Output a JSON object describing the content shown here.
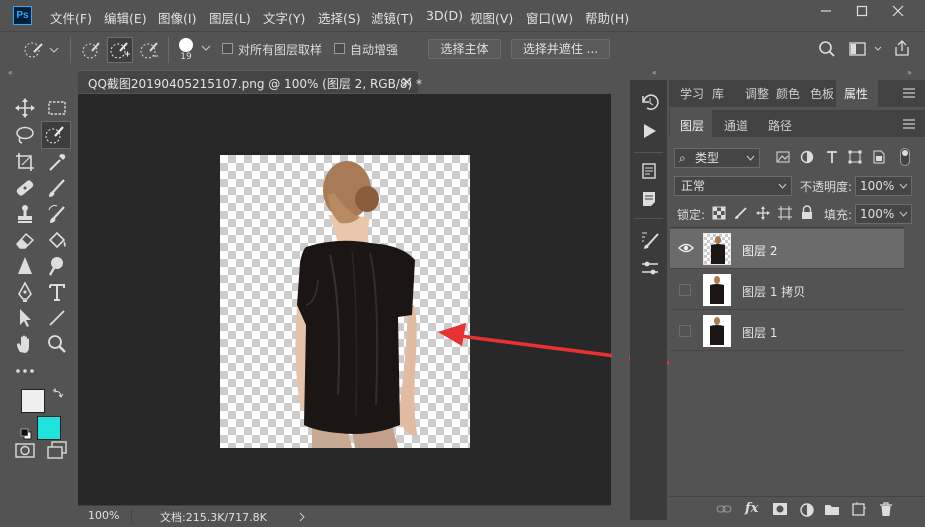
{
  "app": {
    "logo_text": "Ps"
  },
  "menu": [
    "文件(F)",
    "编辑(E)",
    "图像(I)",
    "图层(L)",
    "文字(Y)",
    "选择(S)",
    "滤镜(T)",
    "3D(D)",
    "视图(V)",
    "窗口(W)",
    "帮助(H)"
  ],
  "options_bar": {
    "brush_size": "19",
    "sample_all_layers_label": "对所有图层取样",
    "auto_enhance_label": "自动增强",
    "select_subject_label": "选择主体",
    "select_and_mask_label": "选择并遮住 ..."
  },
  "document": {
    "tab_title": "QQ截图20190405215107.png @ 100% (图层 2, RGB/8) *",
    "zoom": "100%",
    "doc_size": "文档:215.3K/717.8K"
  },
  "panels": {
    "top_tabs": [
      "学习",
      "库",
      "调整",
      "颜色",
      "色板",
      "属性"
    ],
    "layer_tabs": [
      "图层",
      "通道",
      "路径"
    ],
    "filter_kind": "类型",
    "blend_mode": "正常",
    "opacity_label": "不透明度:",
    "opacity_value": "100%",
    "lock_label": "锁定:",
    "fill_label": "填充:",
    "fill_value": "100%"
  },
  "layers": [
    {
      "name": "图层 2",
      "visible": true,
      "selected": true
    },
    {
      "name": "图层 1 拷贝",
      "visible": false,
      "selected": false
    },
    {
      "name": "图层 1",
      "visible": false,
      "selected": false
    }
  ],
  "colors": {
    "foreground": "#f1efed",
    "background": "#21e3de",
    "annotation_arrow": "#e63232"
  }
}
